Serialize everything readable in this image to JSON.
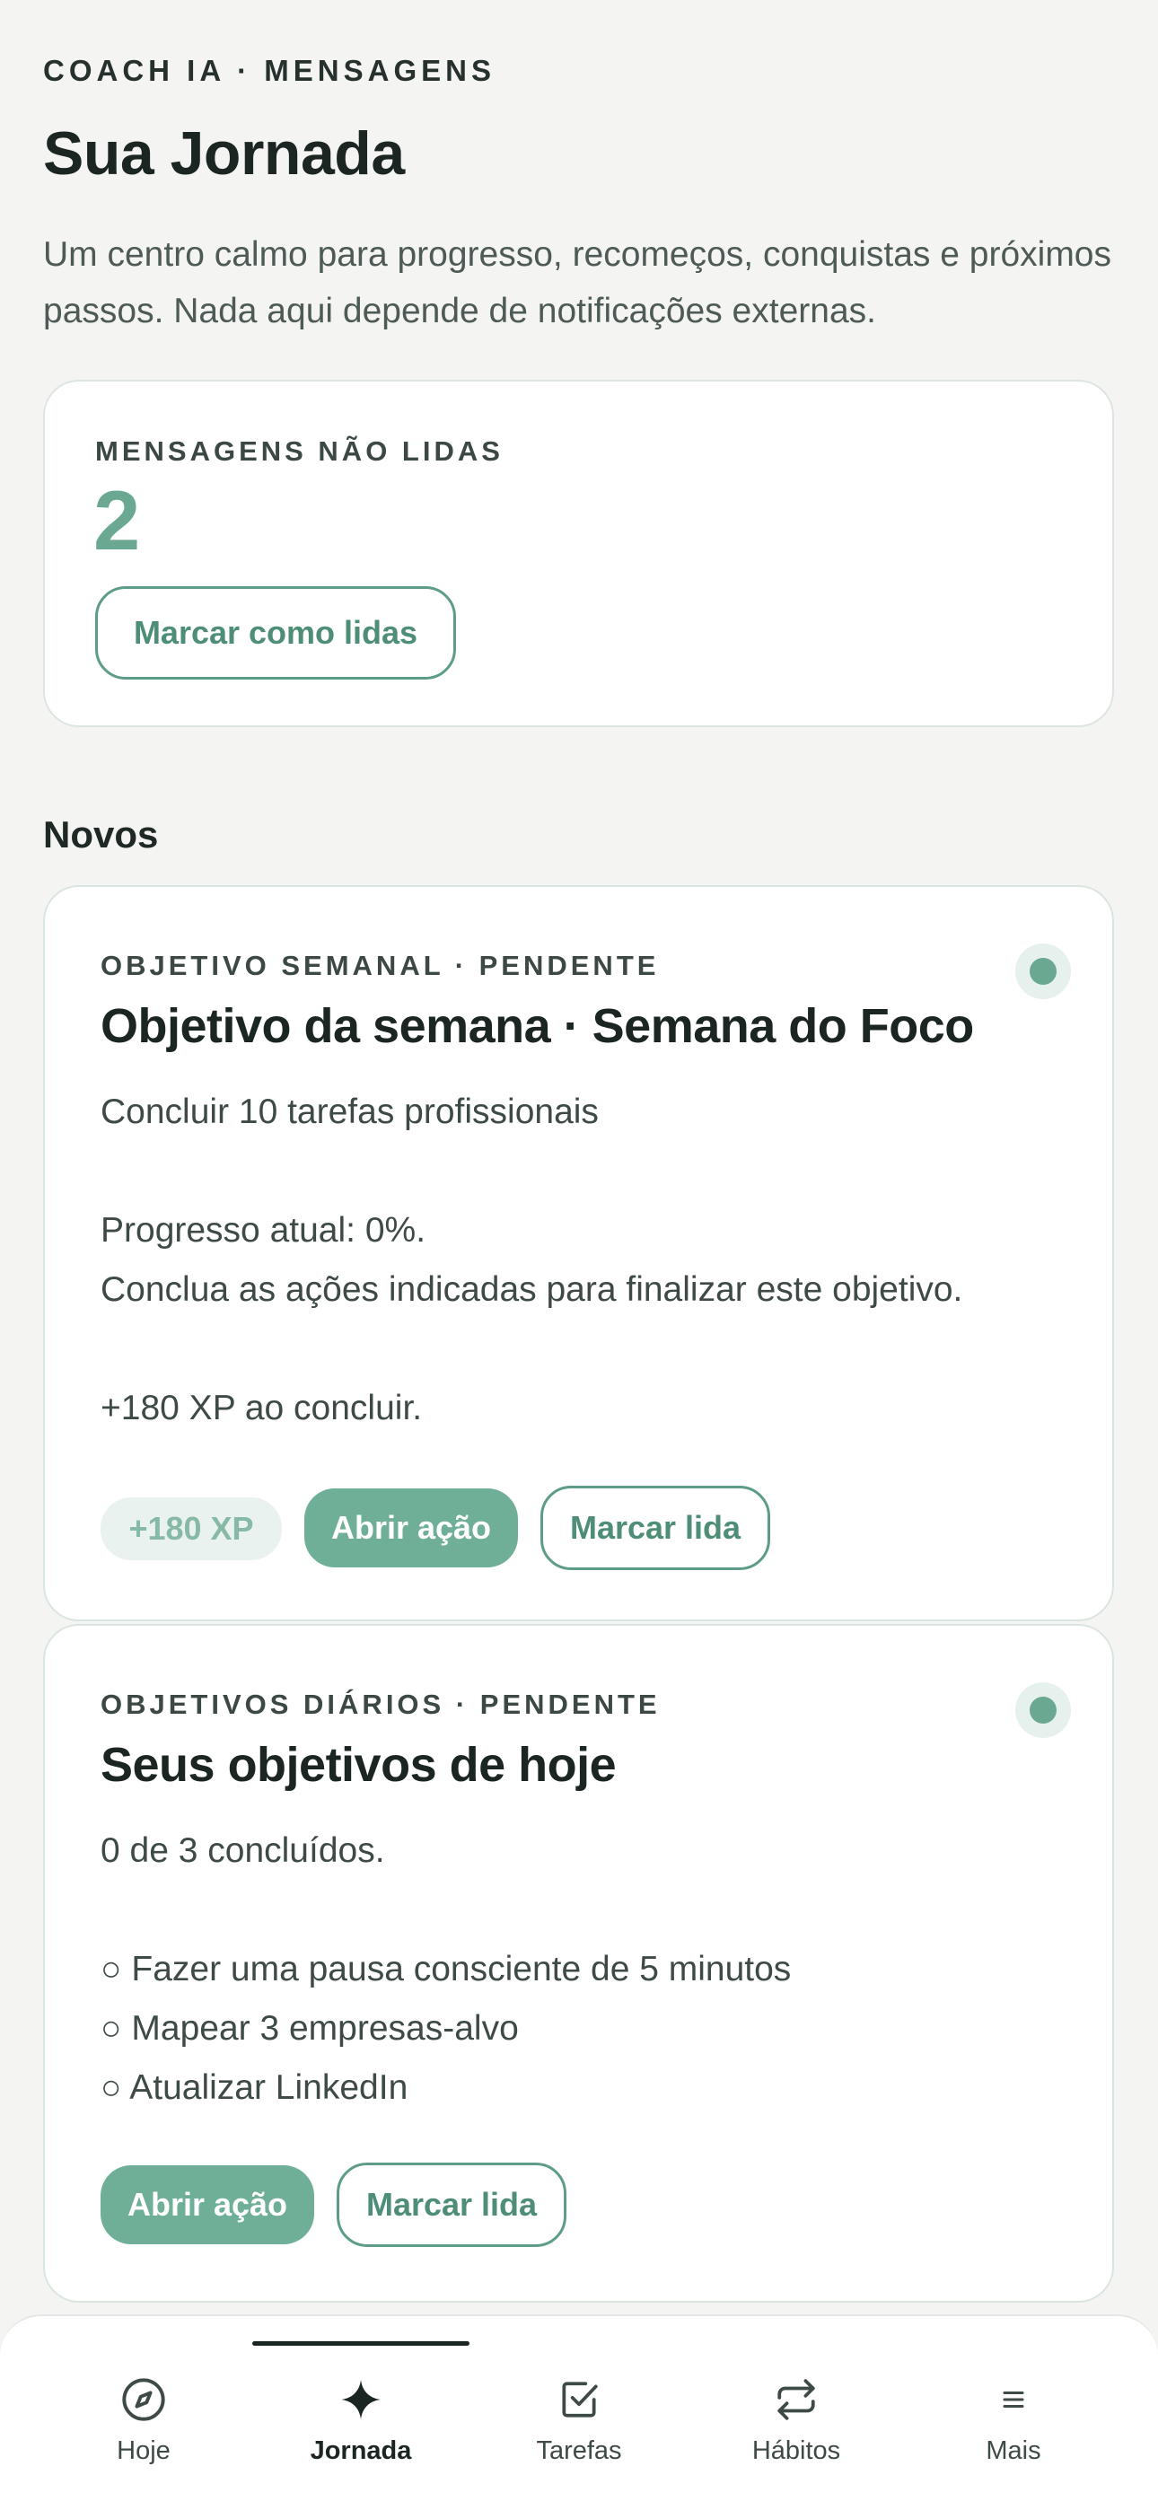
{
  "header": {
    "eyebrow": "COACH IA · MENSAGENS",
    "title": "Sua Jornada",
    "subtitle": "Um centro calmo para progresso, recomeços, conquistas e próximos passos. Nada aqui depende de notificações externas."
  },
  "unread": {
    "label": "MENSAGENS NÃO LIDAS",
    "count": "2",
    "mark_all_label": "Marcar como lidas"
  },
  "section": {
    "title": "Novos"
  },
  "messages": [
    {
      "tag": "OBJETIVO SEMANAL · PENDENTE",
      "title": "Objetivo da semana · Semana do Foco",
      "lines": [
        "Concluir 10 tarefas profissionais",
        "",
        "Progresso atual: 0%.",
        "Conclua as ações indicadas para finalizar este objetivo.",
        "",
        "+180 XP ao concluir."
      ],
      "xp_badge": "+180 XP",
      "open_label": "Abrir ação",
      "mark_label": "Marcar lida"
    },
    {
      "tag": "OBJETIVOS DIÁRIOS · PENDENTE",
      "title": "Seus objetivos de hoje",
      "lines": [
        "0 de 3 concluídos.",
        "",
        "○ Fazer uma pausa consciente de 5 minutos",
        "○ Mapear 3 empresas-alvo",
        "○ Atualizar LinkedIn"
      ],
      "open_label": "Abrir ação",
      "mark_label": "Marcar lida"
    }
  ],
  "tabbar": {
    "items": [
      {
        "label": "Hoje",
        "icon": "compass-icon"
      },
      {
        "label": "Jornada",
        "icon": "sparkle-icon"
      },
      {
        "label": "Tarefas",
        "icon": "checkbox-icon"
      },
      {
        "label": "Hábitos",
        "icon": "repeat-icon"
      },
      {
        "label": "Mais",
        "icon": "menu-icon"
      }
    ],
    "active": "Jornada"
  },
  "colors": {
    "accent": "#6aa892",
    "accent_button": "#6faf98",
    "background": "#f4f4f2"
  }
}
